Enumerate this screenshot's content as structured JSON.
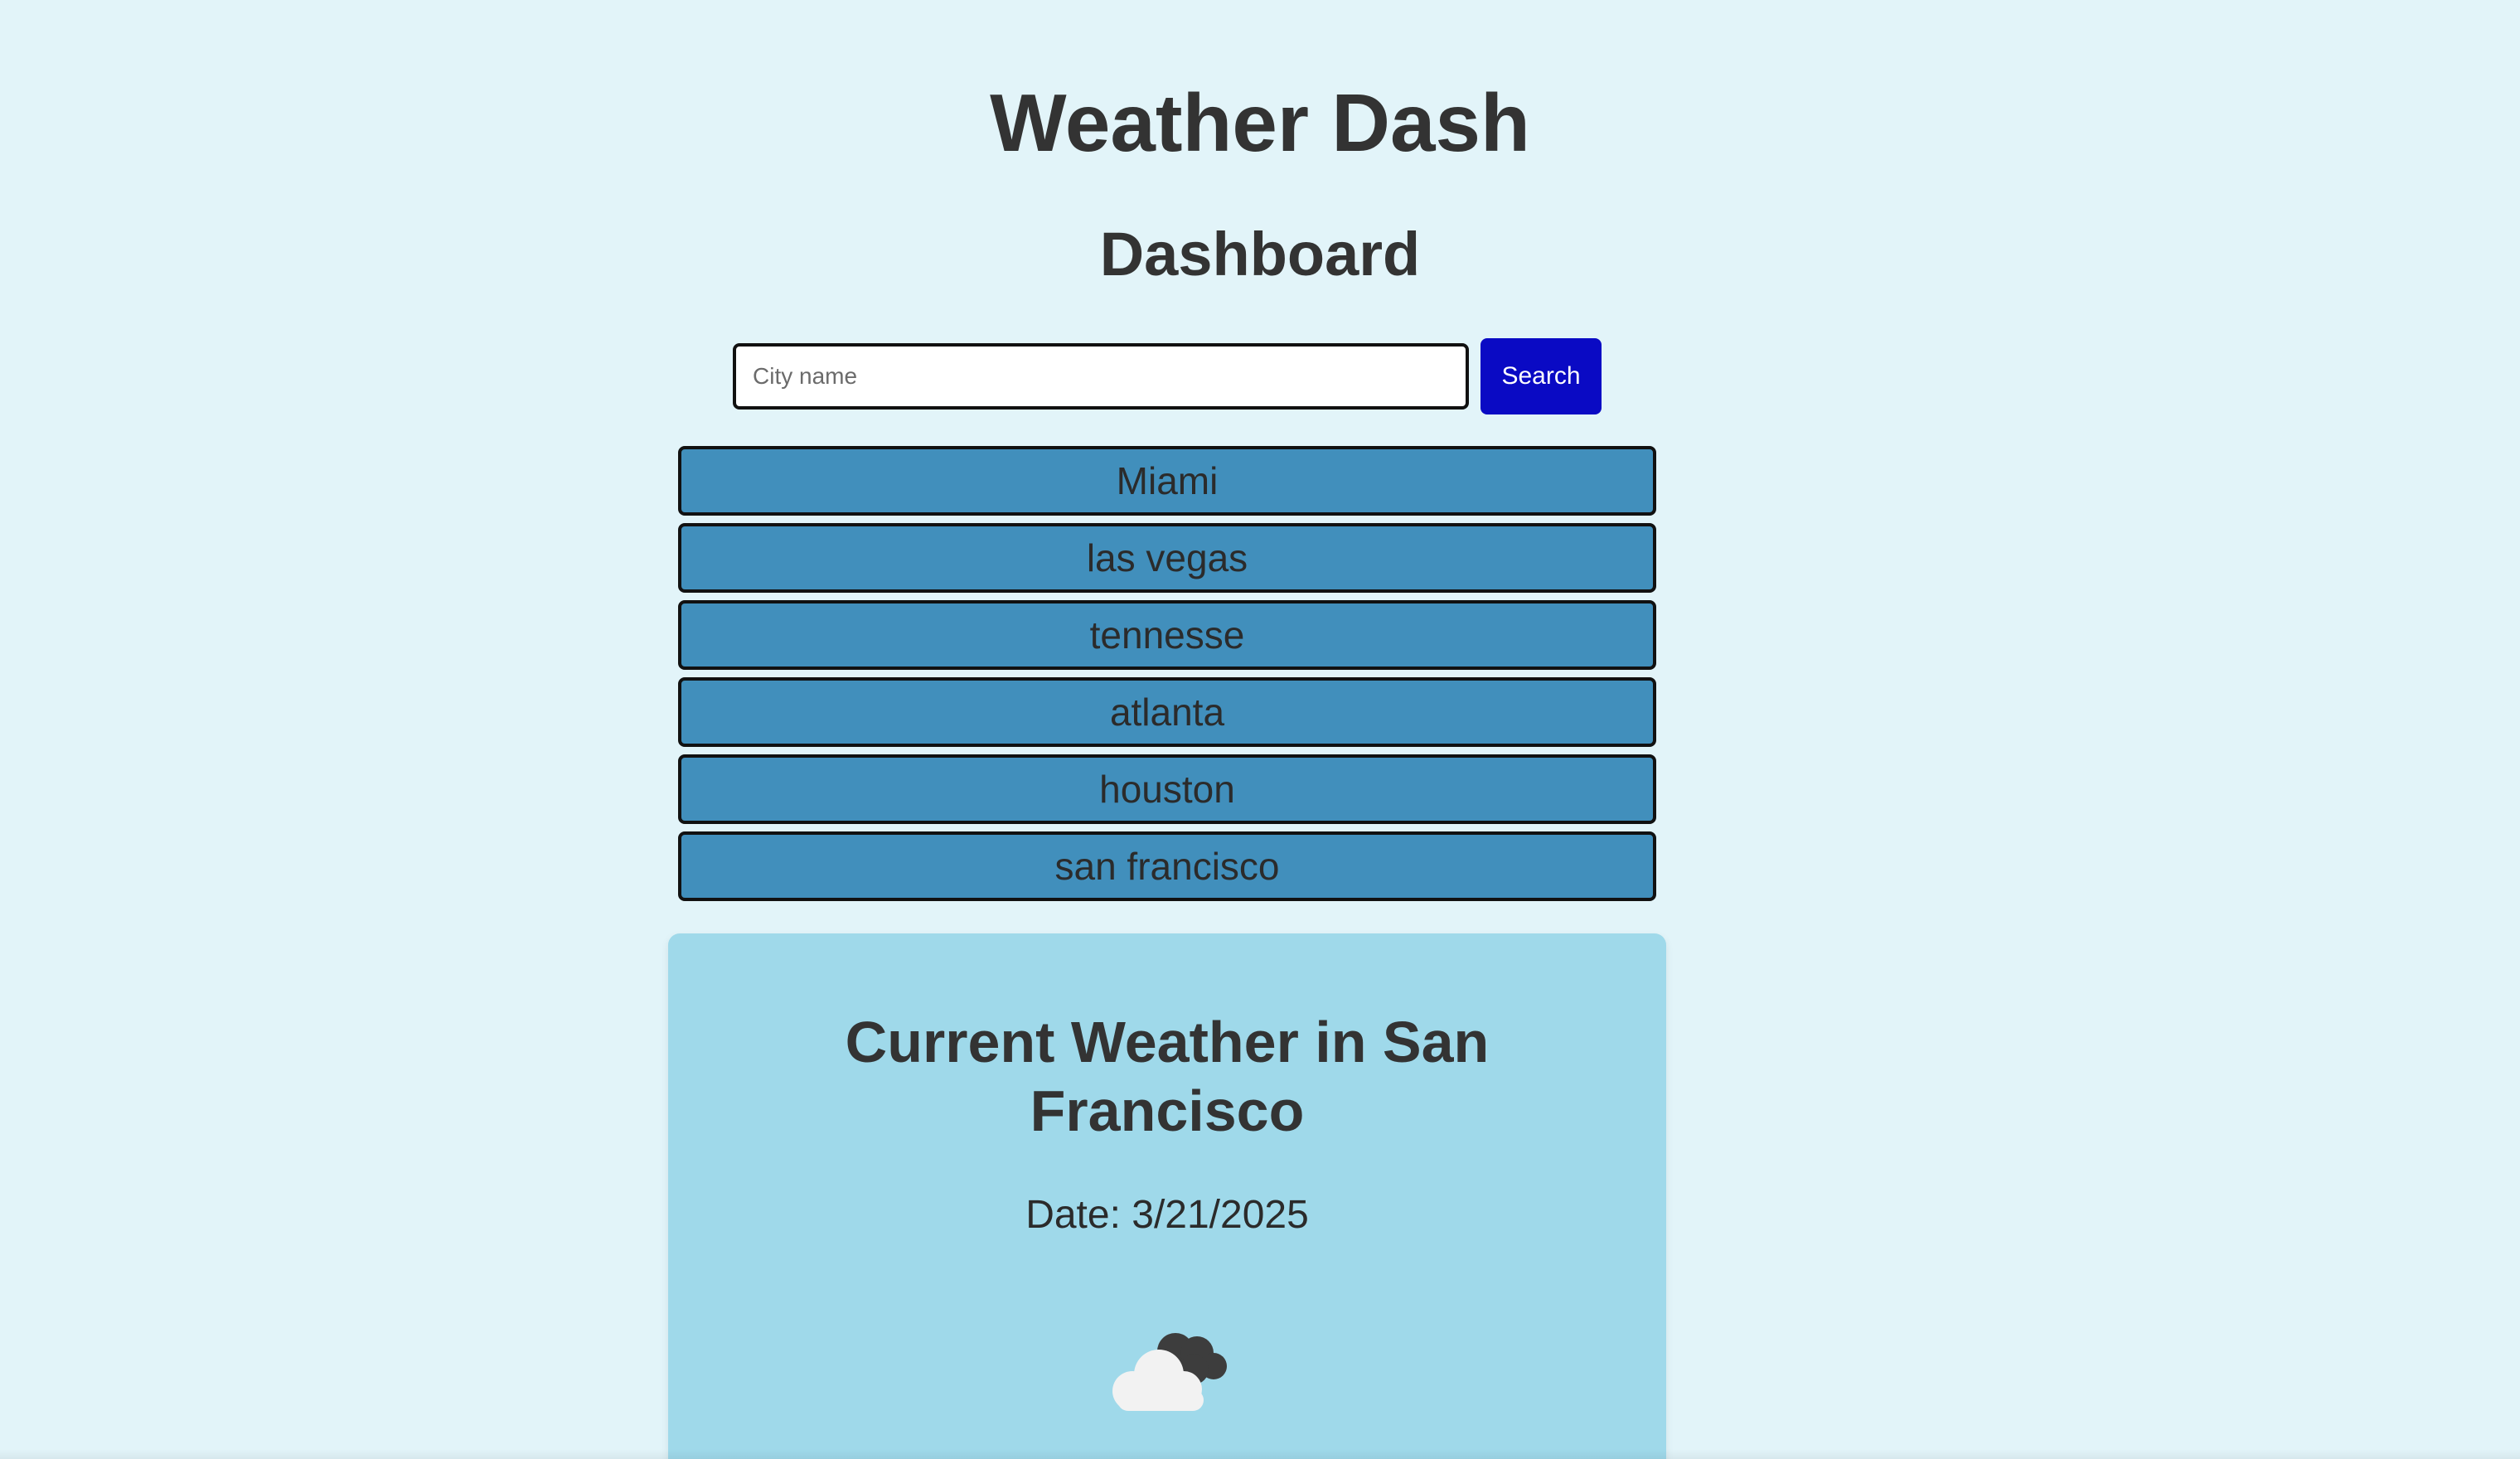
{
  "header": {
    "title": "Weather Dash",
    "subtitle": "Dashboard"
  },
  "search": {
    "placeholder": "City name",
    "value": "",
    "button_label": "Search"
  },
  "history": {
    "cities": [
      "Miami",
      "las vegas",
      "tennesse",
      "atlanta",
      "houston",
      "san francisco"
    ]
  },
  "current_weather": {
    "title": "Current Weather in San Francisco",
    "date": "Date: 3/21/2025",
    "icon": "partly-cloudy-icon"
  },
  "colors": {
    "background": "#e2f4f9",
    "search_button": "#0a0ac4",
    "city_button": "#418fbc",
    "card": "#9fd9ea"
  }
}
